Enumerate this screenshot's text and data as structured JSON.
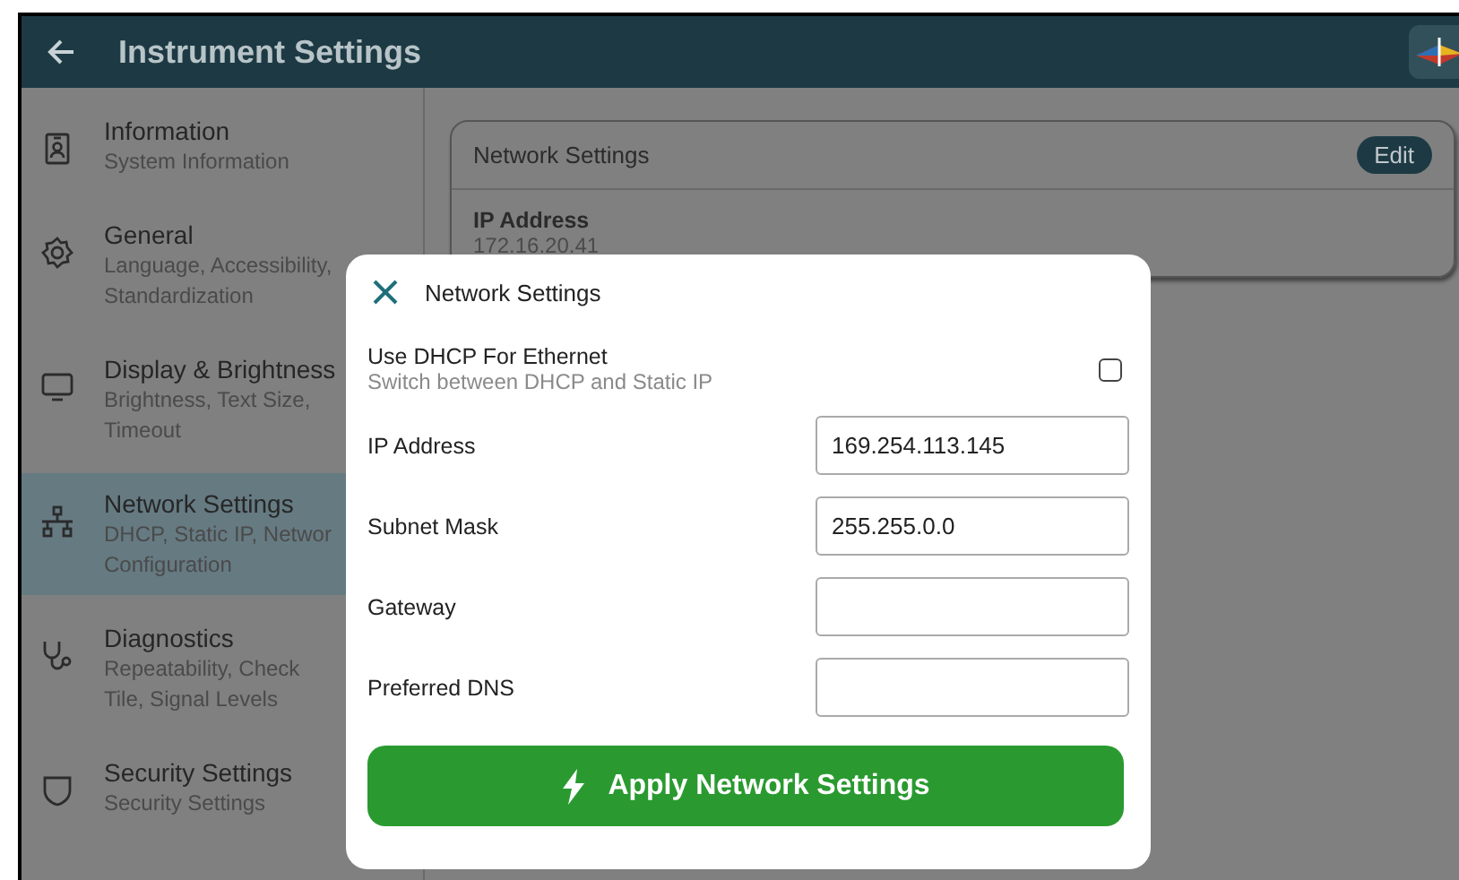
{
  "header": {
    "title": "Instrument Settings"
  },
  "sidebar": {
    "items": [
      {
        "title": "Information",
        "subtitle": "System Information",
        "selected": false
      },
      {
        "title": "General",
        "subtitle": "Language, Accessibility, Standardization",
        "selected": false
      },
      {
        "title": "Display & Brightness",
        "subtitle": "Brightness, Text Size, Timeout",
        "selected": false
      },
      {
        "title": "Network Settings",
        "subtitle": "DHCP, Static IP, Networ Configuration",
        "selected": true
      },
      {
        "title": "Diagnostics",
        "subtitle": "Repeatability, Check Tile, Signal Levels",
        "selected": false
      },
      {
        "title": "Security Settings",
        "subtitle": "Security Settings",
        "selected": false
      }
    ]
  },
  "card": {
    "title": "Network Settings",
    "edit_button": "Edit",
    "field_label": "IP Address",
    "field_value": "172.16.20.41"
  },
  "dialog": {
    "title": "Network Settings",
    "dhcp": {
      "label": "Use DHCP For Ethernet",
      "hint": "Switch between DHCP and Static IP",
      "checked": false
    },
    "fields": [
      {
        "label": "IP Address",
        "value": "169.254.113.145"
      },
      {
        "label": "Subnet Mask",
        "value": "255.255.0.0"
      },
      {
        "label": "Gateway"
      },
      {
        "label": "Preferred DNS"
      }
    ],
    "apply_button": "Apply Network Settings"
  }
}
